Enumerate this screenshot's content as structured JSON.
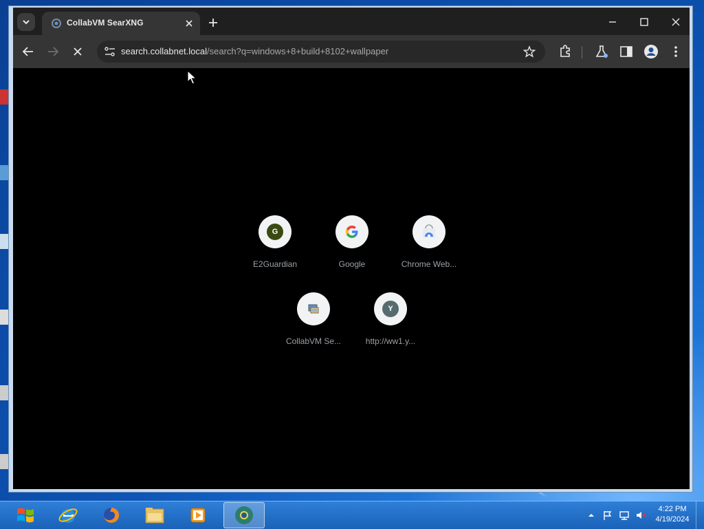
{
  "browser": {
    "tab_title": "CollabVM SearXNG",
    "url_host": "search.collabnet.local",
    "url_path": "/search?q=windows+8+build+8102+wallpaper"
  },
  "shortcuts": [
    {
      "label": "E2Guardian",
      "badge_letter": "G",
      "badge_color": "#3b4a12"
    },
    {
      "label": "Google"
    },
    {
      "label": "Chrome Web..."
    },
    {
      "label": "CollabVM Se..."
    },
    {
      "label": "http://ww1.y...",
      "badge_letter": "Y",
      "badge_color": "#556b6f"
    }
  ],
  "taskbar": {
    "apps": [
      "start-button",
      "internet-explorer-icon",
      "firefox-icon",
      "file-explorer-icon",
      "media-player-icon",
      "chrome-canary-icon"
    ],
    "clock_time": "4:22 PM",
    "clock_date": "4/19/2024"
  },
  "colors": {
    "chrome_bg": "#1f1f1f",
    "toolbar_bg": "#353535",
    "taskbar": "#1a62b8"
  }
}
